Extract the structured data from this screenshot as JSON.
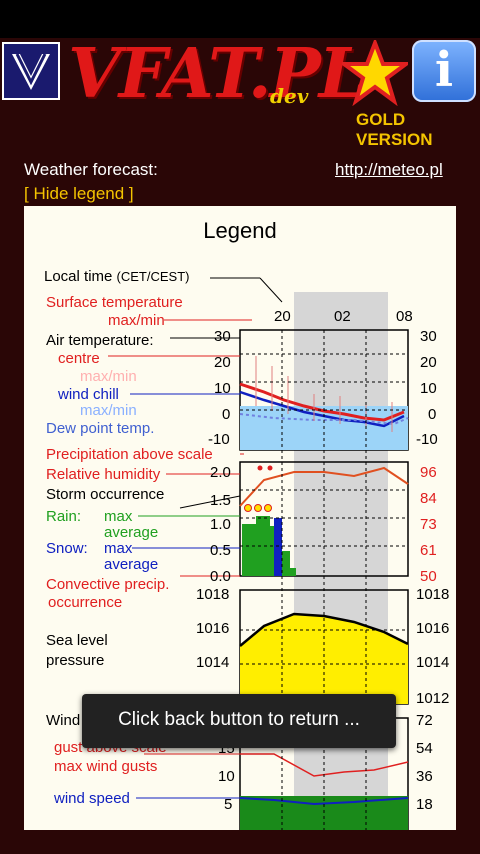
{
  "header": {
    "brand": "VFAT.PL",
    "brand_sub": "dev",
    "gold_label": "GOLD VERSION",
    "info_glyph": "i",
    "logo_glyph": "V",
    "icons": {
      "logo": "vfat-logo-icon",
      "star": "star-icon",
      "info": "info-icon"
    }
  },
  "forecast": {
    "label": "Weather forecast:",
    "link": "http://meteo.pl",
    "hide_legend": "[ Hide legend ]"
  },
  "legend": {
    "title": "Legend",
    "local_time": "Local time",
    "tz": "(CET/CEST)",
    "surface_temp": "Surface temperature",
    "max_min": "max/min",
    "air_temp": "Air temperature:",
    "centre": "centre",
    "max_min2": "max/min",
    "wind_chill": "wind chill",
    "max_min3": "max/min",
    "dew_point": "Dew point temp.",
    "precip_above": "Precipitation above scale",
    "rel_humidity": "Relative humidity",
    "storm": "Storm occurrence",
    "rain": "Rain:",
    "max": "max",
    "average": "average",
    "snow": "Snow:",
    "snow_max": "max",
    "snow_average": "average",
    "conv_precip": "Convective precip.",
    "occurrence": "occurrence",
    "sea_level": "Sea level",
    "pressure": "pressure",
    "wind": "Wind",
    "gust_above": "gust above scale",
    "max_wind_gusts": "max wind gusts",
    "wind_speed": "wind speed"
  },
  "chart": {
    "hours": [
      "20",
      "02",
      "08"
    ],
    "temp_ticks": [
      "30",
      "20",
      "10",
      "0",
      "-10"
    ],
    "precip_ticks": [
      "2.0",
      "1.5",
      "1.0",
      "0.5",
      "0.0"
    ],
    "humidity_ticks": [
      "96",
      "84",
      "73",
      "61",
      "50"
    ],
    "pressure_ticks": [
      "1018",
      "1016",
      "1014"
    ],
    "pressure_ticks_right": [
      "1018",
      "1016",
      "1014",
      "1012"
    ],
    "wind_ticks_left": [
      "15",
      "10",
      "5"
    ],
    "wind_ticks_right": [
      "72",
      "54",
      "36",
      "18"
    ]
  },
  "toast": {
    "text": "Click back button to return ..."
  }
}
